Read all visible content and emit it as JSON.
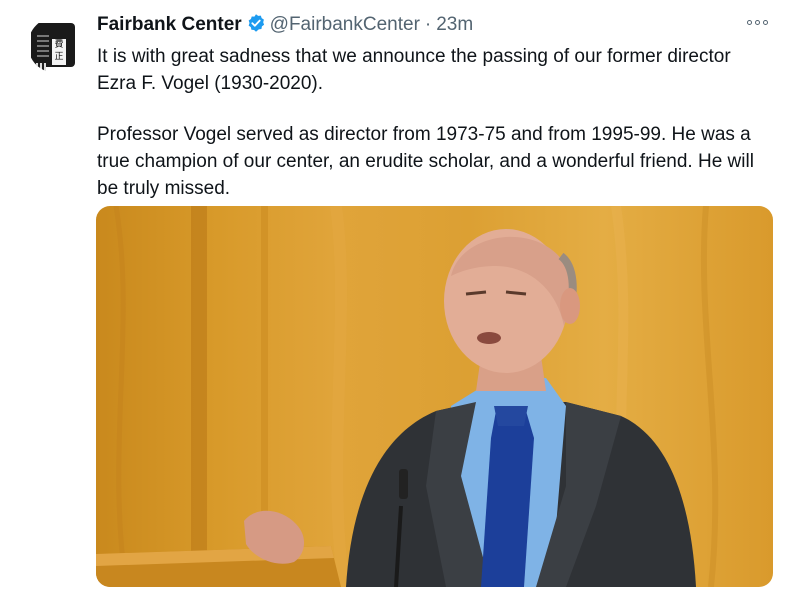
{
  "tweet": {
    "author_name": "Fairbank Center",
    "handle": "@FairbankCenter",
    "separator": "·",
    "time": "23m",
    "avatar_seal_text": "費正",
    "paragraphs": [
      "It is with great sadness that we announce the passing of our former director Ezra F. Vogel (1930-2020).",
      "Professor Vogel served as director from 1973-75 and from 1995-99. He was a true champion of our center, an erudite scholar, and a wonderful friend. He will be truly missed."
    ],
    "icons": {
      "verified": "verified-badge-icon",
      "more": "more-options-icon"
    },
    "colors": {
      "verified_blue": "#1d9bf0",
      "secondary_text": "#536471",
      "background_wood": "#d99b2c"
    }
  }
}
